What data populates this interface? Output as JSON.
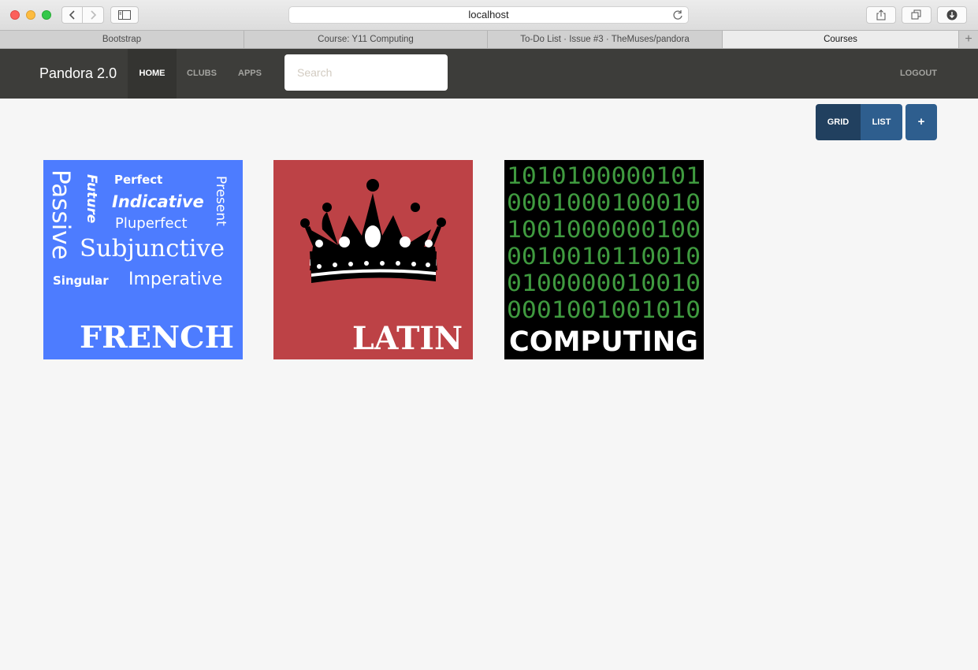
{
  "browser": {
    "url": "localhost",
    "tabs": [
      {
        "label": "Bootstrap"
      },
      {
        "label": "Course: Y11 Computing"
      },
      {
        "label": "To-Do List · Issue #3 · TheMuses/pandora"
      },
      {
        "label": "Courses"
      }
    ],
    "new_tab_label": "+"
  },
  "navbar": {
    "brand": "Pandora 2.0",
    "links": [
      {
        "label": "HOME"
      },
      {
        "label": "CLUBS"
      },
      {
        "label": "APPS"
      }
    ],
    "search_placeholder": "Search",
    "logout": "LOGOUT"
  },
  "view_toggle": {
    "grid": "GRID",
    "list": "LIST",
    "add": "+"
  },
  "colors": {
    "navbar": "#3d3d3a",
    "toggle_active": "#21405f",
    "toggle": "#2e5e8e",
    "french": "#4d7cff",
    "latin": "#bd4246",
    "computing": "#000000"
  },
  "courses": [
    {
      "title": "FRENCH",
      "words": [
        "Passive",
        "Future",
        "Perfect",
        "Indicative",
        "Present",
        "Pluperfect",
        "Subjunctive",
        "Singular",
        "Imperative"
      ]
    },
    {
      "title": "LATIN",
      "icon": "crown-icon"
    },
    {
      "title": "COMPUTING",
      "binary_rows": [
        "1010100000101",
        "0001000100010",
        "1001000000100",
        "0010010110010",
        "0100000010010",
        "0001001001010"
      ]
    }
  ]
}
